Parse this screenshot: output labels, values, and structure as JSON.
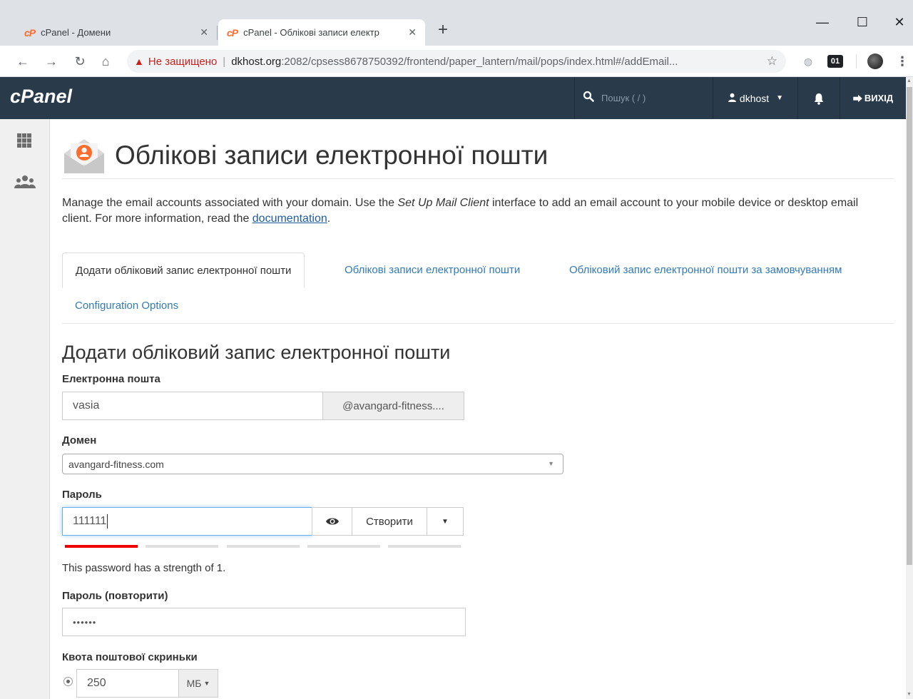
{
  "browser": {
    "tabs": [
      {
        "title": "cPanel - Домени",
        "favicon": "cP"
      },
      {
        "title": "cPanel - Облікові записи електр",
        "favicon": "cP"
      }
    ],
    "new_tab": "+",
    "address": {
      "security_label": "Не защищено",
      "host": "dkhost.org",
      "path": ":2082/cpsess8678750392/frontend/paper_lantern/mail/pops/index.html#/addEmail..."
    },
    "ext_badge": "01",
    "window_controls": {
      "minimize": "—",
      "maximize": "☐",
      "close": "✕"
    }
  },
  "header": {
    "logo": "cPanel",
    "search_placeholder": "Пошук ( / )",
    "user": "dkhost",
    "logout": "ВИХІД"
  },
  "page": {
    "title": "Облікові записи електронної пошти",
    "description_before": "Manage the email accounts associated with your domain. Use the ",
    "description_em": "Set Up Mail Client",
    "description_after": " interface to add an email account to your mobile device or desktop email client. For more information, read the ",
    "description_link": "documentation",
    "description_end": "."
  },
  "tabs": [
    "Додати обліковий запис електронної пошти",
    "Облікові записи електронної пошти",
    "Обліковий запис електронної пошти за замовчуванням",
    "Configuration Options"
  ],
  "form": {
    "section_title": "Додати обліковий запис електронної пошти",
    "email_label": "Електронна пошта",
    "email_value": "vasia",
    "email_domain_addon": "@avangard-fitness....",
    "domain_label": "Домен",
    "domain_value": "avangard-fitness.com",
    "password_label": "Пароль",
    "password_value": "111111",
    "generate_button": "Створити",
    "password_strength": 1,
    "strength_text": "This password has a strength of 1.",
    "password_repeat_label": "Пароль (повторити)",
    "password_repeat_value": "••••••",
    "quota_label": "Квота поштової скриньки",
    "quota_value": "250",
    "quota_unit": "МБ"
  },
  "colors": {
    "header_bg": "#293a4a",
    "link": "#337ab7",
    "strength_weak": "#ee0000",
    "insecure": "#c5221f"
  }
}
